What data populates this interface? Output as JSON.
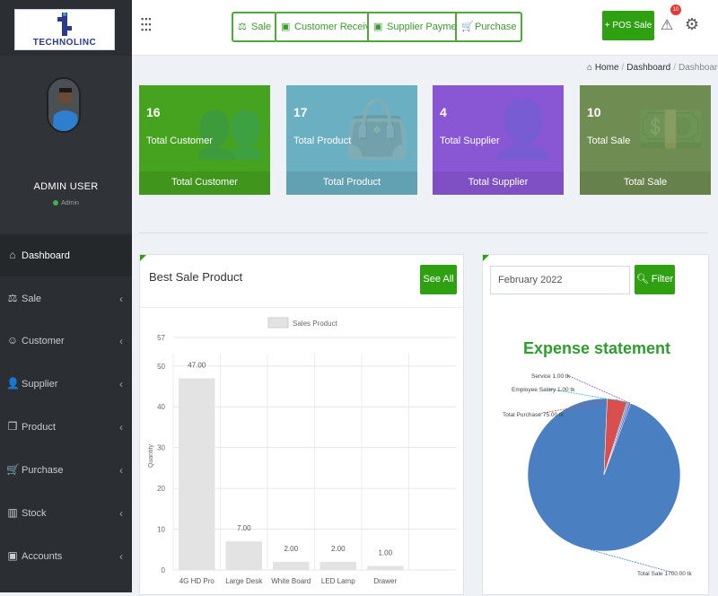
{
  "brand": {
    "logo_text": "TECHNOLINC"
  },
  "profile": {
    "name": "ADMIN USER",
    "role": "Admin"
  },
  "sidebar": {
    "items": [
      {
        "label": "Dashboard",
        "icon": "dashboard-icon",
        "glyph": "⌂",
        "active": true
      },
      {
        "label": "Sale",
        "icon": "scale-icon",
        "glyph": "⚖",
        "active": false
      },
      {
        "label": "Customer",
        "icon": "user-icon",
        "glyph": "☺",
        "active": false
      },
      {
        "label": "Supplier",
        "icon": "user-icon",
        "glyph": "👤",
        "active": false
      },
      {
        "label": "Product",
        "icon": "cubes-icon",
        "glyph": "❒",
        "active": false
      },
      {
        "label": "Purchase",
        "icon": "cart-icon",
        "glyph": "🛒",
        "active": false
      },
      {
        "label": "Stock",
        "icon": "chart-icon",
        "glyph": "▥",
        "active": false
      },
      {
        "label": "Accounts",
        "icon": "money-icon",
        "glyph": "▣",
        "active": false
      }
    ]
  },
  "topbar": {
    "quick_buttons": [
      {
        "label": "Sale",
        "glyph": "⚖"
      },
      {
        "label": "Customer Receive",
        "glyph": "▣"
      },
      {
        "label": "Supplier Payment",
        "glyph": "▣"
      },
      {
        "label": "Purchase",
        "glyph": "🛒"
      }
    ],
    "pos_button": "+ POS Sale",
    "notification_count": "10"
  },
  "breadcrumb": {
    "home": "Home",
    "items": [
      "Dashboard",
      "Dashboard"
    ]
  },
  "stat_cards": [
    {
      "value": "16",
      "label": "Total Customer",
      "footer": "Total Customer",
      "color": "#46a31f",
      "icon": "users-icon"
    },
    {
      "value": "17",
      "label": "Total Product",
      "footer": "Total Product",
      "color": "#6bafc2",
      "icon": "shopping-bag-icon"
    },
    {
      "value": "4",
      "label": "Total Supplier",
      "footer": "Total Supplier",
      "color": "#8a57d4",
      "icon": "user-icon"
    },
    {
      "value": "10",
      "label": "Total Sale",
      "footer": "Total Sale",
      "color": "#6f8d52",
      "icon": "money-icon"
    }
  ],
  "best_sale": {
    "title": "Best Sale Product",
    "see_all": "See All",
    "chart_data": {
      "type": "bar",
      "legend": [
        "Sales Product"
      ],
      "ylabel": "Quantity",
      "categories": [
        "4G HD Pro",
        "Large Desk",
        "White Board",
        "LED Lamp",
        "Drawer"
      ],
      "values": [
        47,
        7,
        2,
        2,
        1
      ],
      "data_labels": [
        "47.00",
        "7.00",
        "2.00",
        "2.00",
        "1.00"
      ],
      "yticks": [
        0,
        10,
        20,
        30,
        40,
        50,
        57
      ],
      "ylim": [
        0,
        57
      ],
      "bar_color": "#e3e3e3"
    }
  },
  "expense": {
    "month": "February 2022",
    "filter": "Filter",
    "chart_data": {
      "type": "pie",
      "title": "Expense statement",
      "slices": [
        {
          "label": "Total Sale",
          "value": 1700,
          "display": "Total Sale 1700.00 tk",
          "color": "#4a7fc1"
        },
        {
          "label": "Total Purchase",
          "value": 75,
          "display": "Total Purchase 75.00 tk",
          "color": "#d94f4f"
        },
        {
          "label": "Employee Salary",
          "value": 1,
          "display": "Employee Salary 1.00 tk",
          "color": "#2bb6c9"
        },
        {
          "label": "Service",
          "value": 1,
          "display": "Service 1.00 tk",
          "color": "#8a57d4"
        }
      ]
    }
  }
}
